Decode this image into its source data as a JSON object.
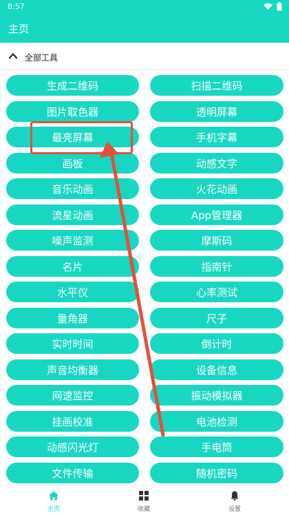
{
  "status_bar": {
    "time": "8:57"
  },
  "app_bar": {
    "title": "主页"
  },
  "section": {
    "label": "全部工具"
  },
  "tools": [
    "生成二维码",
    "扫描二维码",
    "图片取色器",
    "透明屏幕",
    "最亮屏幕",
    "手机字幕",
    "画板",
    "动感文字",
    "音乐动画",
    "火花动画",
    "流星动画",
    "App管理器",
    "噪声监测",
    "摩斯码",
    "名片",
    "指南针",
    "水平仪",
    "心率测试",
    "量角器",
    "尺子",
    "实时时间",
    "倒计时",
    "声音均衡器",
    "设备信息",
    "网速监控",
    "振动模拟器",
    "挂画校准",
    "电池检测",
    "动感闪光灯",
    "手电筒",
    "文件传输",
    "随机密码"
  ],
  "bottom_nav": [
    {
      "label": "主页",
      "icon": "home-icon",
      "active": true
    },
    {
      "label": "收藏",
      "icon": "grid-icon",
      "active": false
    },
    {
      "label": "设置",
      "icon": "bell-icon",
      "active": false
    }
  ],
  "colors": {
    "accent": "#18d7c2",
    "annotation": "#e0513a",
    "text_on_accent": "#ffffff"
  }
}
